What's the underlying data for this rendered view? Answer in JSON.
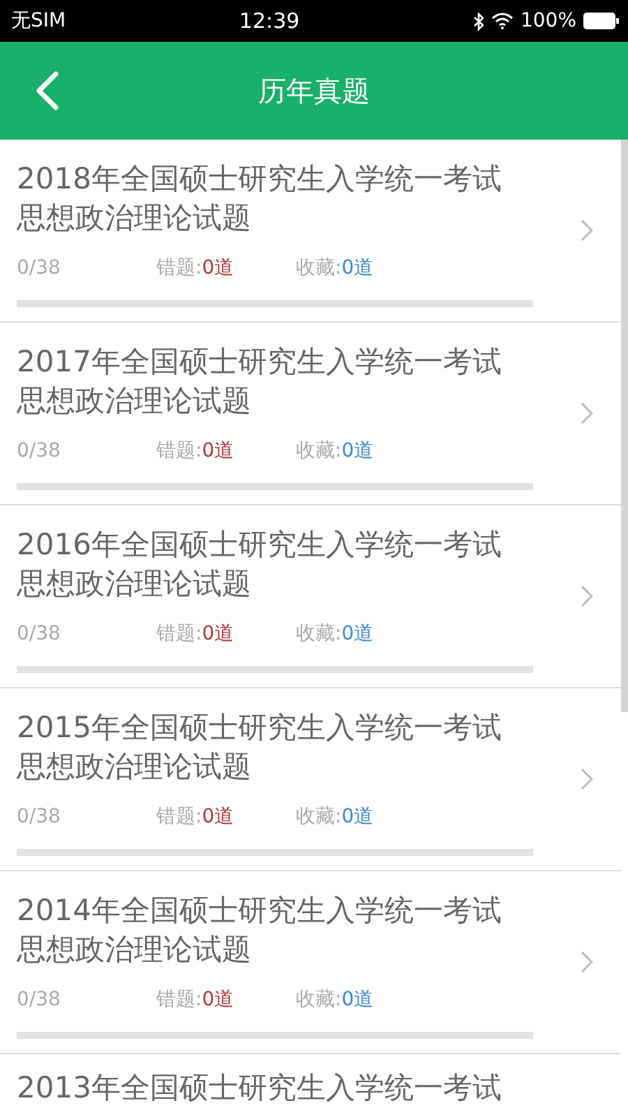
{
  "status_bar": {
    "carrier": "无SIM",
    "time": "12:39",
    "battery": "100%"
  },
  "header": {
    "title": "历年真题"
  },
  "items": [
    {
      "title": "2018年全国硕士研究生入学统一考试思想政治理论试题",
      "progress": "0/38",
      "wrong_label": "错题:",
      "wrong_count": "0道",
      "fav_label": "收藏:",
      "fav_count": "0道",
      "level": 0
    },
    {
      "title": "2017年全国硕士研究生入学统一考试思想政治理论试题",
      "progress": "0/38",
      "wrong_label": "错题:",
      "wrong_count": "0道",
      "fav_label": "收藏:",
      "fav_count": "0道",
      "level": 0
    },
    {
      "title": "2016年全国硕士研究生入学统一考试思想政治理论试题",
      "progress": "0/38",
      "wrong_label": "错题:",
      "wrong_count": "0道",
      "fav_label": "收藏:",
      "fav_count": "0道",
      "level": 0
    },
    {
      "title": "2015年全国硕士研究生入学统一考试思想政治理论试题",
      "progress": "0/38",
      "wrong_label": "错题:",
      "wrong_count": "0道",
      "fav_label": "收藏:",
      "fav_count": "0道",
      "level": 0
    },
    {
      "title": "2014年全国硕士研究生入学统一考试思想政治理论试题",
      "progress": "0/38",
      "wrong_label": "错题:",
      "wrong_count": "0道",
      "fav_label": "收藏:",
      "fav_count": "0道",
      "level": 0
    },
    {
      "title": "2013年全国硕士研究生入学统一考试"
    }
  ]
}
